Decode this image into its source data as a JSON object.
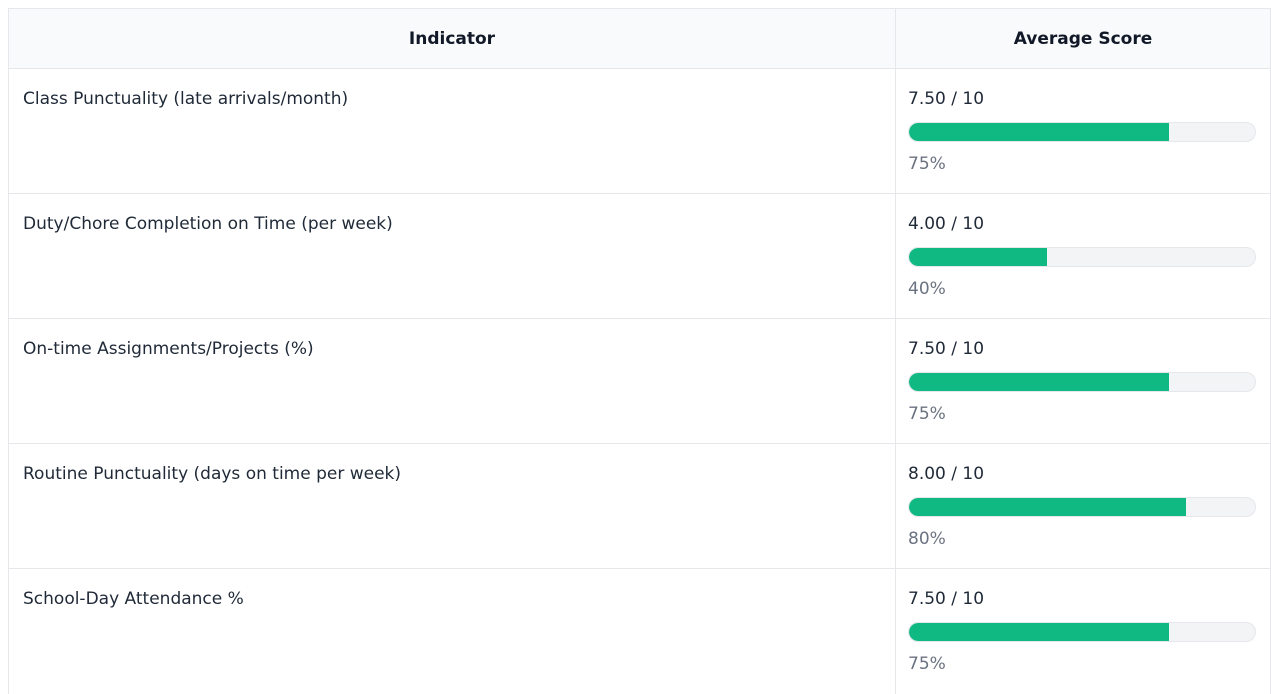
{
  "table": {
    "headers": {
      "indicator": "Indicator",
      "score": "Average Score"
    },
    "rows": [
      {
        "indicator": "Class Punctuality (late arrivals/month)",
        "score_text": "7.50 / 10",
        "percent_text": "75%",
        "fill": 0.75
      },
      {
        "indicator": "Duty/Chore Completion on Time (per week)",
        "score_text": "4.00 / 10",
        "percent_text": "40%",
        "fill": 0.4
      },
      {
        "indicator": "On-time Assignments/Projects (%)",
        "score_text": "7.50 / 10",
        "percent_text": "75%",
        "fill": 0.75
      },
      {
        "indicator": "Routine Punctuality (days on time per week)",
        "score_text": "8.00 / 10",
        "percent_text": "80%",
        "fill": 0.8
      },
      {
        "indicator": "School-Day Attendance %",
        "score_text": "7.50 / 10",
        "percent_text": "75%",
        "fill": 0.75
      }
    ]
  },
  "colors": {
    "bar_fill": "#10b981",
    "bar_track": "#f3f4f6"
  }
}
